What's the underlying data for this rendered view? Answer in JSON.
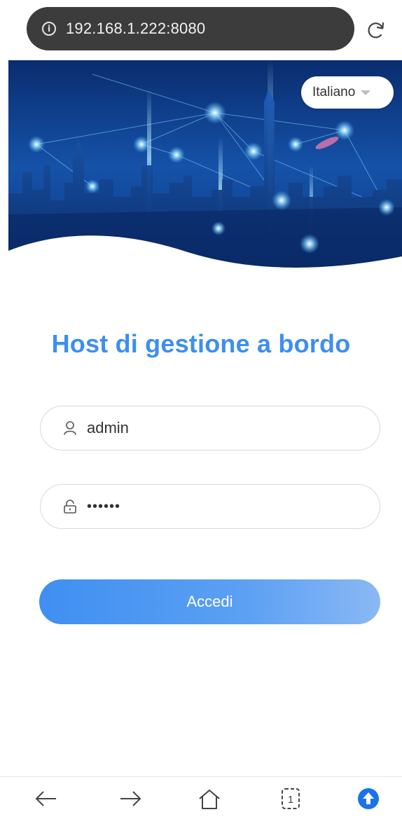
{
  "browser": {
    "url": "192.168.1.222:8080",
    "info_icon": "info-icon",
    "reload_icon": "reload-icon"
  },
  "banner": {
    "language": {
      "selected": "Italiano",
      "caret_icon": "chevron-down-icon"
    }
  },
  "login": {
    "title": "Host di gestione a bordo",
    "username": {
      "value": "admin",
      "icon": "user-icon"
    },
    "password": {
      "value": "••••••",
      "icon": "lock-icon"
    },
    "submit_label": "Accedi"
  },
  "toolbar": {
    "items": [
      "back-arrow-icon",
      "forward-arrow-icon",
      "home-icon",
      "tabs-icon",
      "upload-icon"
    ],
    "tab_count": "1"
  },
  "colors": {
    "accent": "#3d8ef0",
    "address_bar": "#3c3c3c",
    "upload": "#1a73e8"
  }
}
